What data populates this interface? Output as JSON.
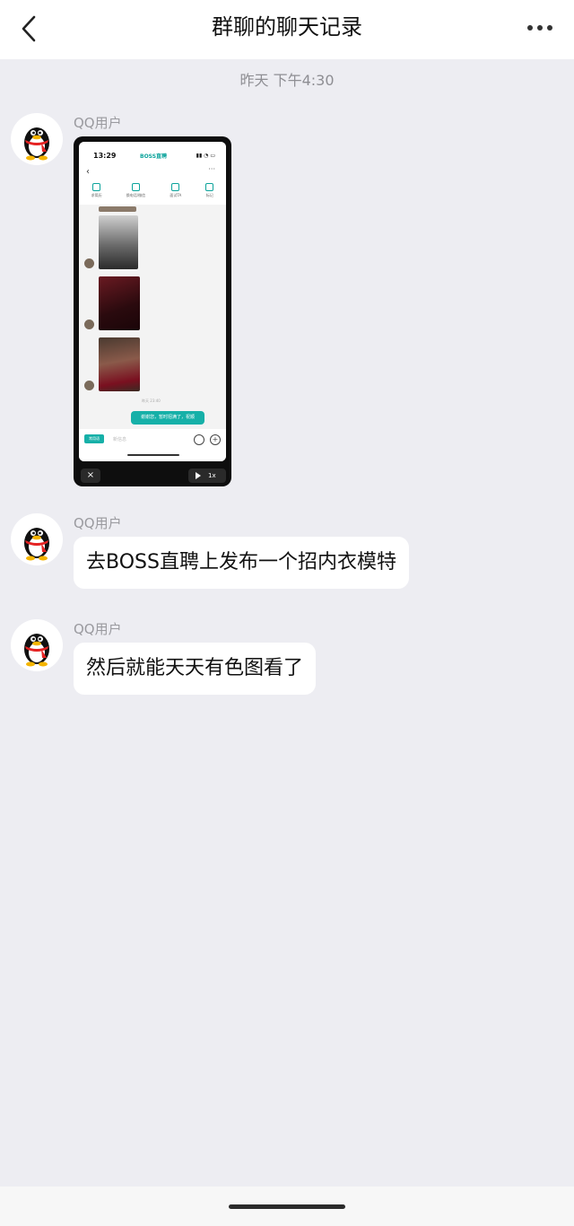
{
  "header": {
    "title": "群聊的聊天记录"
  },
  "timestamp": "昨天 下午4:30",
  "messages": [
    {
      "sender": "QQ用户",
      "type": "image",
      "image": {
        "status_time": "13:29",
        "app_title": "BOSS直聘",
        "tools": [
          "求简历",
          "换电话/微信",
          "面试TA",
          "标记"
        ],
        "day_time": "昨天 23:40",
        "green_message": "谢谢您，暂时招满了，祝顺",
        "input_tag": "常用语",
        "input_placeholder": "新信息",
        "speed": "1x"
      }
    },
    {
      "sender": "QQ用户",
      "type": "text",
      "text": "去BOSS直聘上发布一个招内衣模特"
    },
    {
      "sender": "QQ用户",
      "type": "text",
      "text": "然后就能天天有色图看了"
    }
  ]
}
